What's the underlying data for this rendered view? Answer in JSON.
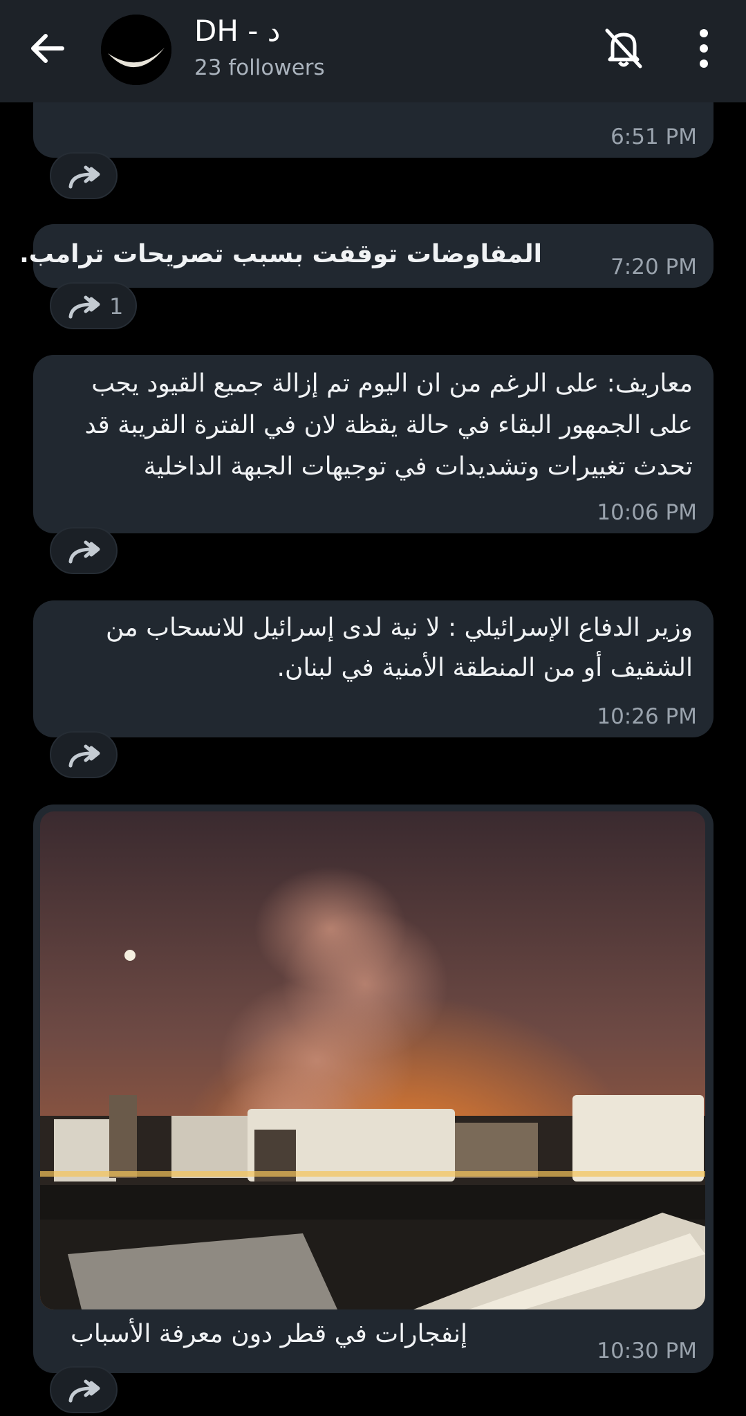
{
  "header": {
    "title": "DH - د",
    "subtitle": "23 followers",
    "icons": {
      "back": "arrow-left-icon",
      "mute": "bell-off-icon",
      "menu": "more-vertical-icon",
      "avatar": "crescent-moon-avatar"
    }
  },
  "colors": {
    "background": "#000000",
    "topbar": "#1d2228",
    "bubble": "#212830",
    "muted_text": "#9aa3ad"
  },
  "messages": [
    {
      "text": "",
      "time": "6:51 PM",
      "shares": ""
    },
    {
      "text": "المفاوضات توقفت بسبب تصريحات ترامب.",
      "time": "7:20 PM",
      "shares": "1"
    },
    {
      "lines": [
        "معاريف: على الرغم من ان اليوم تم إزالة جميع القيود يجب",
        "على الجمهور البقاء في حالة يقظة لان في الفترة القريبة قد",
        "تحدث تغييرات وتشديدات في توجيهات الجبهة الداخلية"
      ],
      "time": "10:06 PM",
      "shares": ""
    },
    {
      "lines": [
        "وزير الدفاع الإسرائيلي  : لا نية لدى إسرائيل للانسحاب من",
        "الشقيف أو من المنطقة الأمنية في لبنان."
      ],
      "time": "10:26 PM",
      "shares": ""
    },
    {
      "caption": "إنفجارات في قطر دون معرفة الأسباب",
      "time": "10:30 PM",
      "shares": "",
      "photo_icon": "industrial-night-photo"
    }
  ]
}
